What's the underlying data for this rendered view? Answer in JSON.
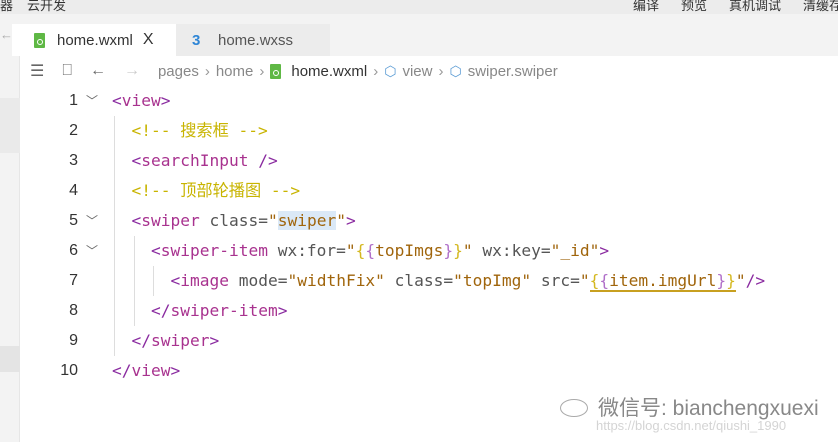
{
  "topbar": {
    "left": [
      "器",
      "云开发"
    ],
    "right": [
      "编译",
      "预览",
      "真机调试",
      "清缓存"
    ]
  },
  "tabs": [
    {
      "label": "home.wxml",
      "icon": "wxml-file-icon",
      "active": true,
      "close": "X"
    },
    {
      "label": "home.wxss",
      "icon": "css-file-icon",
      "active": false
    }
  ],
  "breadcrumb": [
    "pages",
    "home",
    "home.wxml",
    "view",
    "swiper.swiper"
  ],
  "colors": {
    "tag": "#a8328f",
    "attr": "#555555",
    "string": "#a0650c",
    "comment": "#c8b400",
    "brace": "#d4b820"
  },
  "code": [
    {
      "n": "1",
      "fold": true,
      "indent": 0,
      "tokens": [
        [
          "<",
          "punc"
        ],
        [
          "view",
          "tag"
        ],
        [
          ">",
          "punc"
        ]
      ]
    },
    {
      "n": "2",
      "fold": false,
      "indent": 1,
      "tokens": [
        [
          "<!-- 搜索框 -->",
          "comment"
        ]
      ]
    },
    {
      "n": "3",
      "fold": false,
      "indent": 1,
      "tokens": [
        [
          "<",
          "punc"
        ],
        [
          "searchInput",
          "tag"
        ],
        [
          " />",
          "punc"
        ]
      ]
    },
    {
      "n": "4",
      "fold": false,
      "indent": 1,
      "tokens": [
        [
          "<!-- 顶部轮播图 -->",
          "comment"
        ]
      ]
    },
    {
      "n": "5",
      "fold": true,
      "indent": 1,
      "tokens": [
        [
          "<",
          "punc"
        ],
        [
          "swiper",
          "tag"
        ],
        [
          " class=",
          "attr"
        ],
        [
          "\"",
          "str"
        ],
        [
          "swiper",
          "str hl"
        ],
        [
          "\"",
          "str"
        ],
        [
          ">",
          "punc"
        ]
      ]
    },
    {
      "n": "6",
      "fold": true,
      "indent": 2,
      "tokens": [
        [
          "<",
          "punc"
        ],
        [
          "swiper-item",
          "tag"
        ],
        [
          " wx:for=",
          "attr"
        ],
        [
          "\"",
          "str"
        ],
        [
          "{",
          "brace"
        ],
        [
          "{",
          "brace2"
        ],
        [
          "topImgs",
          "expr"
        ],
        [
          "}",
          "brace2"
        ],
        [
          "}",
          "brace"
        ],
        [
          "\"",
          "str"
        ],
        [
          " wx:key=",
          "attr"
        ],
        [
          "\"_id\"",
          "str"
        ],
        [
          ">",
          "punc"
        ]
      ]
    },
    {
      "n": "7",
      "fold": false,
      "indent": 3,
      "tokens": [
        [
          "<",
          "punc"
        ],
        [
          "image",
          "tag"
        ],
        [
          " mode=",
          "attr"
        ],
        [
          "\"widthFix\"",
          "str"
        ],
        [
          " class=",
          "attr"
        ],
        [
          "\"topImg\"",
          "str"
        ],
        [
          " src=",
          "attr"
        ],
        [
          "\"",
          "str"
        ],
        [
          "{",
          "brace ul"
        ],
        [
          "{",
          "brace2 ul"
        ],
        [
          "item.imgUrl",
          "expr ul"
        ],
        [
          "}",
          "brace2 ul"
        ],
        [
          "}",
          "brace ul"
        ],
        [
          "\"",
          "str"
        ],
        [
          "/>",
          "punc"
        ]
      ]
    },
    {
      "n": "8",
      "fold": false,
      "indent": 2,
      "tokens": [
        [
          "</",
          "punc"
        ],
        [
          "swiper-item",
          "tag"
        ],
        [
          ">",
          "punc"
        ]
      ]
    },
    {
      "n": "9",
      "fold": false,
      "indent": 1,
      "tokens": [
        [
          "</",
          "punc"
        ],
        [
          "swiper",
          "tag"
        ],
        [
          ">",
          "punc"
        ]
      ]
    },
    {
      "n": "10",
      "fold": false,
      "indent": 0,
      "tokens": [
        [
          "</",
          "punc"
        ],
        [
          "view",
          "tag"
        ],
        [
          ">",
          "punc"
        ]
      ]
    }
  ],
  "watermark": {
    "text": "微信号: bianchengxuexi",
    "url": "https://blog.csdn.net/qiushi_1990"
  }
}
